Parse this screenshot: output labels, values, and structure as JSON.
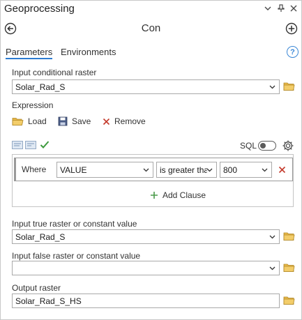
{
  "window": {
    "title": "Geoprocessing",
    "tool_name": "Con"
  },
  "tabs": [
    {
      "label": "Parameters"
    },
    {
      "label": "Environments"
    }
  ],
  "params": {
    "input_conditional_raster": {
      "label": "Input conditional raster",
      "value": "Solar_Rad_S"
    },
    "expression": {
      "label": "Expression"
    },
    "input_true": {
      "label": "Input true raster or constant value",
      "value": "Solar_Rad_S"
    },
    "input_false": {
      "label": "Input false raster or constant value",
      "value": ""
    },
    "output": {
      "label": "Output raster",
      "value": "Solar_Rad_S_HS"
    }
  },
  "expression_actions": {
    "load": "Load",
    "save": "Save",
    "remove": "Remove"
  },
  "sql_label": "SQL",
  "clause": {
    "where_label": "Where",
    "field": "VALUE",
    "operator": "is greater than",
    "value": "800"
  },
  "add_clause_label": "Add Clause",
  "help_glyph": "?",
  "colors": {
    "accent_blue": "#2b7bd1",
    "folder_yellow": "#e8b84a",
    "remove_red": "#c43a2c",
    "add_green": "#4a9a4a",
    "check_green": "#3d9a3d"
  }
}
